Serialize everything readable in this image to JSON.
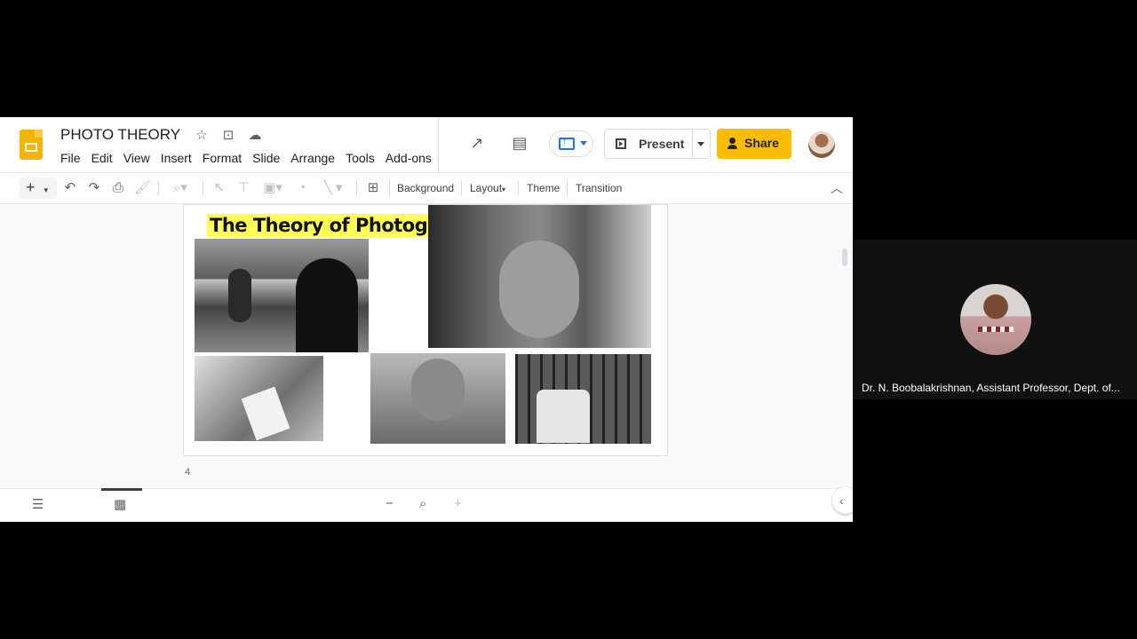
{
  "app": {
    "doc_title": "PHOTO THEORY",
    "menu": [
      "File",
      "Edit",
      "View",
      "Insert",
      "Format",
      "Slide",
      "Arrange",
      "Tools",
      "Add-ons"
    ],
    "present_label": "Present",
    "share_label": "Share"
  },
  "toolbar": {
    "plus": "+",
    "background_label": "Background",
    "layout_label": "Layout",
    "theme_label": "Theme",
    "transition_label": "Transition"
  },
  "slide": {
    "title": "The Theory of Photography",
    "number": "4"
  },
  "video": {
    "participant_name": "Dr. N. Boobalakrishnan, Assistant Professor, Dept. of..."
  },
  "colors": {
    "share_yellow": "#fbbc04",
    "slides_logo": "#f4b400",
    "title_highlight": "#ffff55"
  }
}
